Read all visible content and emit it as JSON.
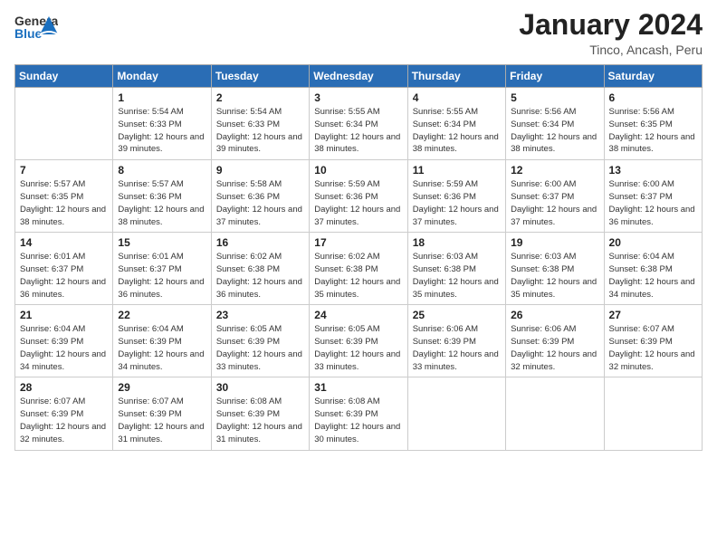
{
  "logo": {
    "general": "General",
    "blue": "Blue"
  },
  "header": {
    "month": "January 2024",
    "location": "Tinco, Ancash, Peru"
  },
  "weekdays": [
    "Sunday",
    "Monday",
    "Tuesday",
    "Wednesday",
    "Thursday",
    "Friday",
    "Saturday"
  ],
  "weeks": [
    [
      {
        "day": "",
        "info": ""
      },
      {
        "day": "1",
        "info": "Sunrise: 5:54 AM\nSunset: 6:33 PM\nDaylight: 12 hours\nand 39 minutes."
      },
      {
        "day": "2",
        "info": "Sunrise: 5:54 AM\nSunset: 6:33 PM\nDaylight: 12 hours\nand 39 minutes."
      },
      {
        "day": "3",
        "info": "Sunrise: 5:55 AM\nSunset: 6:34 PM\nDaylight: 12 hours\nand 38 minutes."
      },
      {
        "day": "4",
        "info": "Sunrise: 5:55 AM\nSunset: 6:34 PM\nDaylight: 12 hours\nand 38 minutes."
      },
      {
        "day": "5",
        "info": "Sunrise: 5:56 AM\nSunset: 6:34 PM\nDaylight: 12 hours\nand 38 minutes."
      },
      {
        "day": "6",
        "info": "Sunrise: 5:56 AM\nSunset: 6:35 PM\nDaylight: 12 hours\nand 38 minutes."
      }
    ],
    [
      {
        "day": "7",
        "info": "Sunrise: 5:57 AM\nSunset: 6:35 PM\nDaylight: 12 hours\nand 38 minutes."
      },
      {
        "day": "8",
        "info": "Sunrise: 5:57 AM\nSunset: 6:36 PM\nDaylight: 12 hours\nand 38 minutes."
      },
      {
        "day": "9",
        "info": "Sunrise: 5:58 AM\nSunset: 6:36 PM\nDaylight: 12 hours\nand 37 minutes."
      },
      {
        "day": "10",
        "info": "Sunrise: 5:59 AM\nSunset: 6:36 PM\nDaylight: 12 hours\nand 37 minutes."
      },
      {
        "day": "11",
        "info": "Sunrise: 5:59 AM\nSunset: 6:36 PM\nDaylight: 12 hours\nand 37 minutes."
      },
      {
        "day": "12",
        "info": "Sunrise: 6:00 AM\nSunset: 6:37 PM\nDaylight: 12 hours\nand 37 minutes."
      },
      {
        "day": "13",
        "info": "Sunrise: 6:00 AM\nSunset: 6:37 PM\nDaylight: 12 hours\nand 36 minutes."
      }
    ],
    [
      {
        "day": "14",
        "info": "Sunrise: 6:01 AM\nSunset: 6:37 PM\nDaylight: 12 hours\nand 36 minutes."
      },
      {
        "day": "15",
        "info": "Sunrise: 6:01 AM\nSunset: 6:37 PM\nDaylight: 12 hours\nand 36 minutes."
      },
      {
        "day": "16",
        "info": "Sunrise: 6:02 AM\nSunset: 6:38 PM\nDaylight: 12 hours\nand 36 minutes."
      },
      {
        "day": "17",
        "info": "Sunrise: 6:02 AM\nSunset: 6:38 PM\nDaylight: 12 hours\nand 35 minutes."
      },
      {
        "day": "18",
        "info": "Sunrise: 6:03 AM\nSunset: 6:38 PM\nDaylight: 12 hours\nand 35 minutes."
      },
      {
        "day": "19",
        "info": "Sunrise: 6:03 AM\nSunset: 6:38 PM\nDaylight: 12 hours\nand 35 minutes."
      },
      {
        "day": "20",
        "info": "Sunrise: 6:04 AM\nSunset: 6:38 PM\nDaylight: 12 hours\nand 34 minutes."
      }
    ],
    [
      {
        "day": "21",
        "info": "Sunrise: 6:04 AM\nSunset: 6:39 PM\nDaylight: 12 hours\nand 34 minutes."
      },
      {
        "day": "22",
        "info": "Sunrise: 6:04 AM\nSunset: 6:39 PM\nDaylight: 12 hours\nand 34 minutes."
      },
      {
        "day": "23",
        "info": "Sunrise: 6:05 AM\nSunset: 6:39 PM\nDaylight: 12 hours\nand 33 minutes."
      },
      {
        "day": "24",
        "info": "Sunrise: 6:05 AM\nSunset: 6:39 PM\nDaylight: 12 hours\nand 33 minutes."
      },
      {
        "day": "25",
        "info": "Sunrise: 6:06 AM\nSunset: 6:39 PM\nDaylight: 12 hours\nand 33 minutes."
      },
      {
        "day": "26",
        "info": "Sunrise: 6:06 AM\nSunset: 6:39 PM\nDaylight: 12 hours\nand 32 minutes."
      },
      {
        "day": "27",
        "info": "Sunrise: 6:07 AM\nSunset: 6:39 PM\nDaylight: 12 hours\nand 32 minutes."
      }
    ],
    [
      {
        "day": "28",
        "info": "Sunrise: 6:07 AM\nSunset: 6:39 PM\nDaylight: 12 hours\nand 32 minutes."
      },
      {
        "day": "29",
        "info": "Sunrise: 6:07 AM\nSunset: 6:39 PM\nDaylight: 12 hours\nand 31 minutes."
      },
      {
        "day": "30",
        "info": "Sunrise: 6:08 AM\nSunset: 6:39 PM\nDaylight: 12 hours\nand 31 minutes."
      },
      {
        "day": "31",
        "info": "Sunrise: 6:08 AM\nSunset: 6:39 PM\nDaylight: 12 hours\nand 30 minutes."
      },
      {
        "day": "",
        "info": ""
      },
      {
        "day": "",
        "info": ""
      },
      {
        "day": "",
        "info": ""
      }
    ]
  ]
}
